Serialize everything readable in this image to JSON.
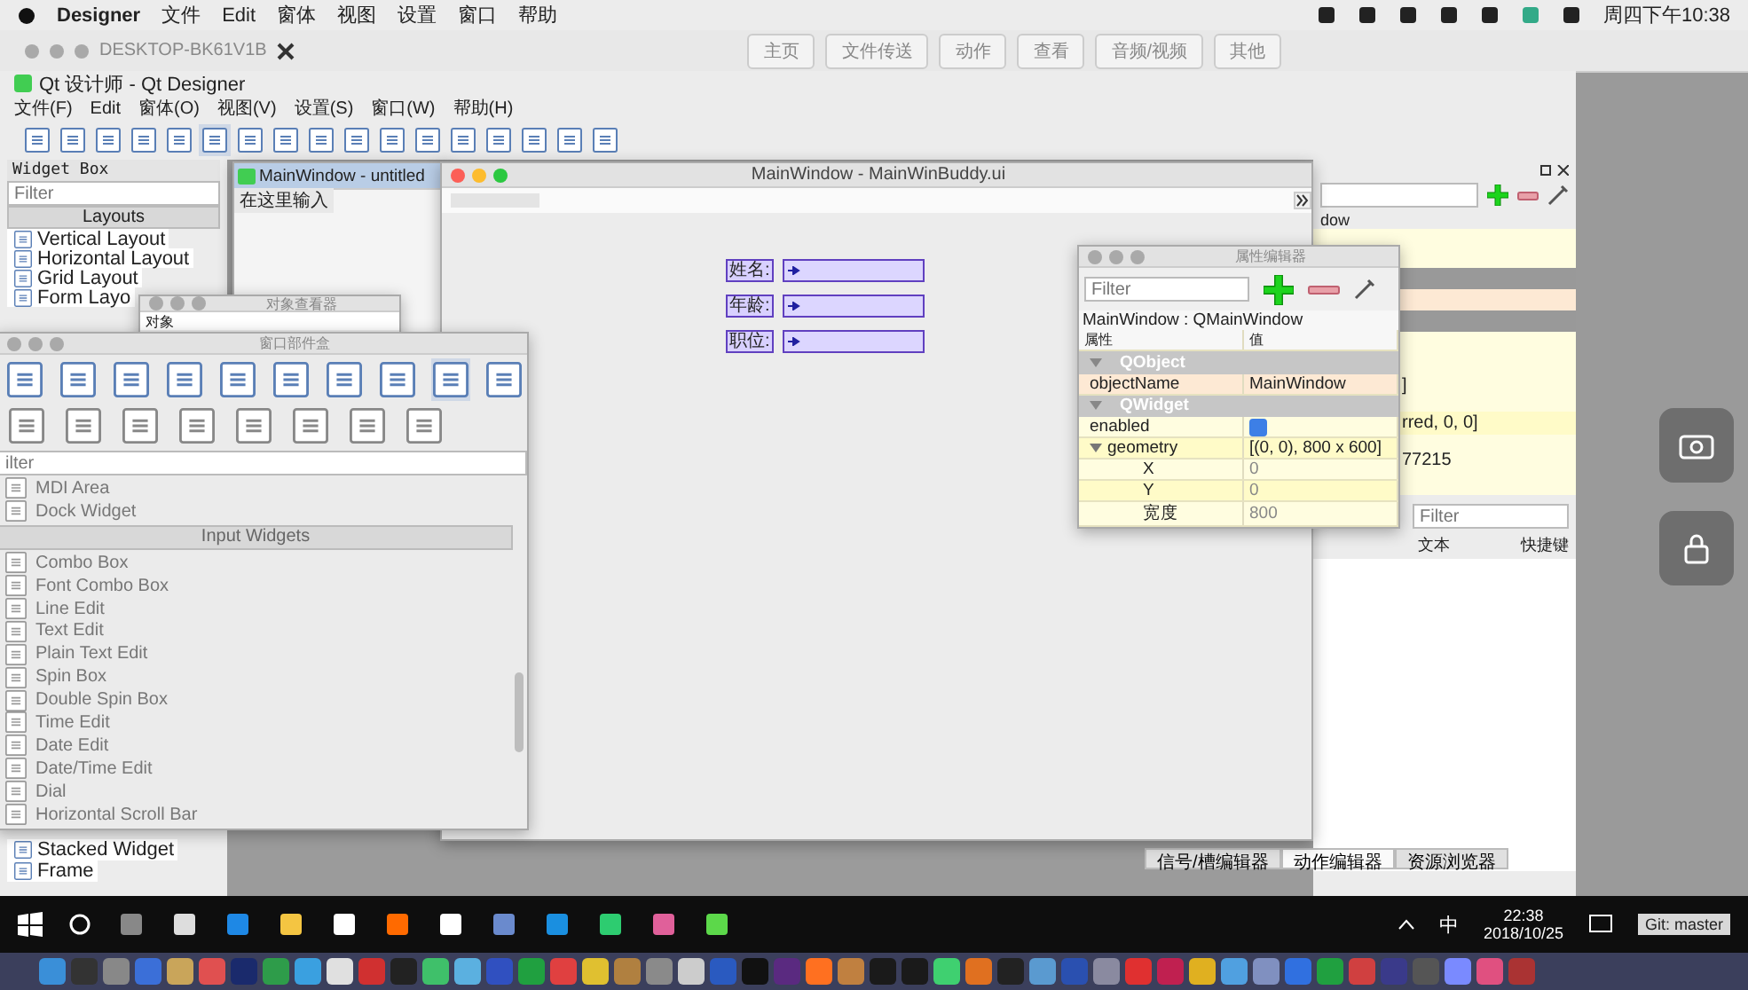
{
  "mac_menubar": {
    "app": "Designer",
    "menus": [
      "文件",
      "Edit",
      "窗体",
      "视图",
      "设置",
      "窗口",
      "帮助"
    ],
    "clock": "周四下午10:38"
  },
  "remote_toolbar": {
    "host": "DESKTOP-BK61V1B",
    "buttons": [
      "主页",
      "文件传送",
      "动作",
      "查看",
      "音频/视频",
      "其他"
    ]
  },
  "designer": {
    "title": "Qt 设计师 - Qt Designer",
    "menus": [
      "文件(F)",
      "Edit",
      "窗体(O)",
      "视图(V)",
      "设置(S)",
      "窗口(W)",
      "帮助(H)"
    ]
  },
  "widget_box_dock": {
    "title": "Widget Box",
    "filter_placeholder": "Filter",
    "category": "Layouts",
    "items": [
      "Vertical Layout",
      "Horizontal Layout",
      "Grid Layout",
      "Form Layo"
    ],
    "bottom_items": [
      "Stacked Widget",
      "Frame"
    ]
  },
  "form_window": {
    "title": "MainWindow - untitled",
    "menu_hint": "在这里输入"
  },
  "object_inspector": {
    "title": "对象查看器",
    "column_1": "对象"
  },
  "widget_box_float": {
    "title": "窗口部件盒",
    "filter_placeholder": "ilter",
    "items": [
      {
        "kind": "item",
        "label": "MDI Area"
      },
      {
        "kind": "item",
        "label": "Dock Widget"
      },
      {
        "kind": "category",
        "label": "Input Widgets"
      },
      {
        "kind": "item",
        "label": "Combo Box"
      },
      {
        "kind": "item",
        "label": "Font Combo Box"
      },
      {
        "kind": "item",
        "label": "Line Edit"
      },
      {
        "kind": "item",
        "label": "Text Edit"
      },
      {
        "kind": "item",
        "label": "Plain Text Edit"
      },
      {
        "kind": "item",
        "label": "Spin Box"
      },
      {
        "kind": "item",
        "label": "Double Spin Box"
      },
      {
        "kind": "item",
        "label": "Time Edit"
      },
      {
        "kind": "item",
        "label": "Date Edit"
      },
      {
        "kind": "item",
        "label": "Date/Time Edit"
      },
      {
        "kind": "item",
        "label": "Dial"
      },
      {
        "kind": "item",
        "label": "Horizontal Scroll Bar"
      }
    ]
  },
  "preview": {
    "title": "MainWindow - MainWinBuddy.ui",
    "fields": [
      {
        "label": "姓名:"
      },
      {
        "label": "年龄:"
      },
      {
        "label": "职位:"
      }
    ]
  },
  "property_editor": {
    "title": "属性编辑器",
    "filter_placeholder": "Filter",
    "object": "MainWindow : QMainWindow",
    "columns": [
      "属性",
      "值"
    ],
    "groups": [
      {
        "name": "QObject",
        "expanded": true,
        "properties": [
          {
            "kind": "text",
            "name": "objectName",
            "value": "MainWindow",
            "changed": true
          }
        ]
      },
      {
        "name": "QWidget",
        "expanded": true,
        "properties": [
          {
            "kind": "check",
            "name": "enabled",
            "checked": true,
            "changed": false
          },
          {
            "kind": "text",
            "name": "geometry",
            "value": "[(0, 0), 800 x 600]",
            "changed": true,
            "expanded": true,
            "children": [
              {
                "kind": "text",
                "name": "X",
                "value": "0",
                "changed": false
              },
              {
                "kind": "text",
                "name": "Y",
                "value": "0",
                "changed": false
              },
              {
                "kind": "text",
                "name": "宽度",
                "value": "800",
                "changed": false
              }
            ]
          }
        ]
      }
    ]
  },
  "back_dock": {
    "header": "dow",
    "values": [
      "]",
      "rred, 0, 0]",
      "77215"
    ],
    "filter_placeholder": "Filter",
    "columns": [
      "文本",
      "快捷键"
    ],
    "tabs": [
      {
        "label": "信号/槽编辑器",
        "selected": false
      },
      {
        "label": "动作编辑器",
        "selected": true
      },
      {
        "label": "资源浏览器",
        "selected": false
      }
    ]
  },
  "taskbar": {
    "ime": "中",
    "time": "22:38",
    "date": "2018/10/25",
    "git": "Git: master"
  }
}
